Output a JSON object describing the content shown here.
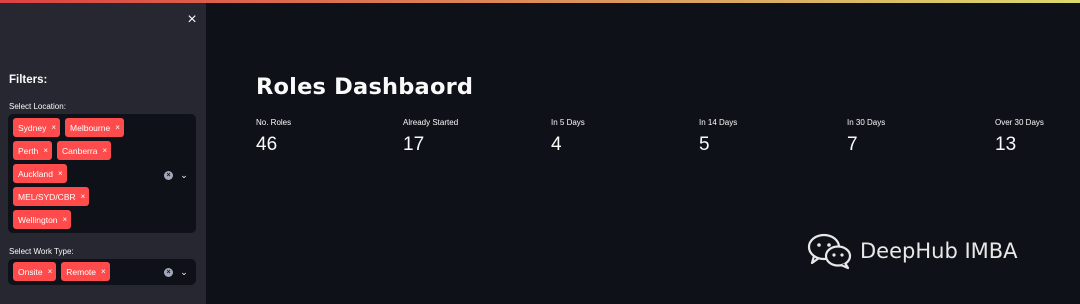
{
  "sidebar": {
    "close_icon": "×",
    "filters_heading": "Filters:",
    "location": {
      "label": "Select Location:",
      "chips": [
        "Sydney",
        "Melbourne",
        "Perth",
        "Canberra",
        "Auckland",
        "MEL/SYD/CBR",
        "Wellington"
      ]
    },
    "work_type": {
      "label": "Select Work Type:",
      "chips": [
        "Onsite",
        "Remote"
      ]
    },
    "chip_remove": "×",
    "clear_icon": "×",
    "chevron_icon": "⌄"
  },
  "main": {
    "title": "Roles Dashbaord",
    "metrics": [
      {
        "label": "No. Roles",
        "value": "46"
      },
      {
        "label": "Already Started",
        "value": "17"
      },
      {
        "label": "In 5 Days",
        "value": "4"
      },
      {
        "label": "In 14 Days",
        "value": "5"
      },
      {
        "label": "In 30 Days",
        "value": "7"
      },
      {
        "label": "Over 30 Days",
        "value": "13"
      }
    ]
  },
  "watermark": {
    "text": "DeepHub IMBA",
    "icon": "wechat-icon"
  },
  "colors": {
    "background": "#0e1117",
    "sidebar": "#262730",
    "chip": "#ff4b4b",
    "text": "#fafafa"
  }
}
